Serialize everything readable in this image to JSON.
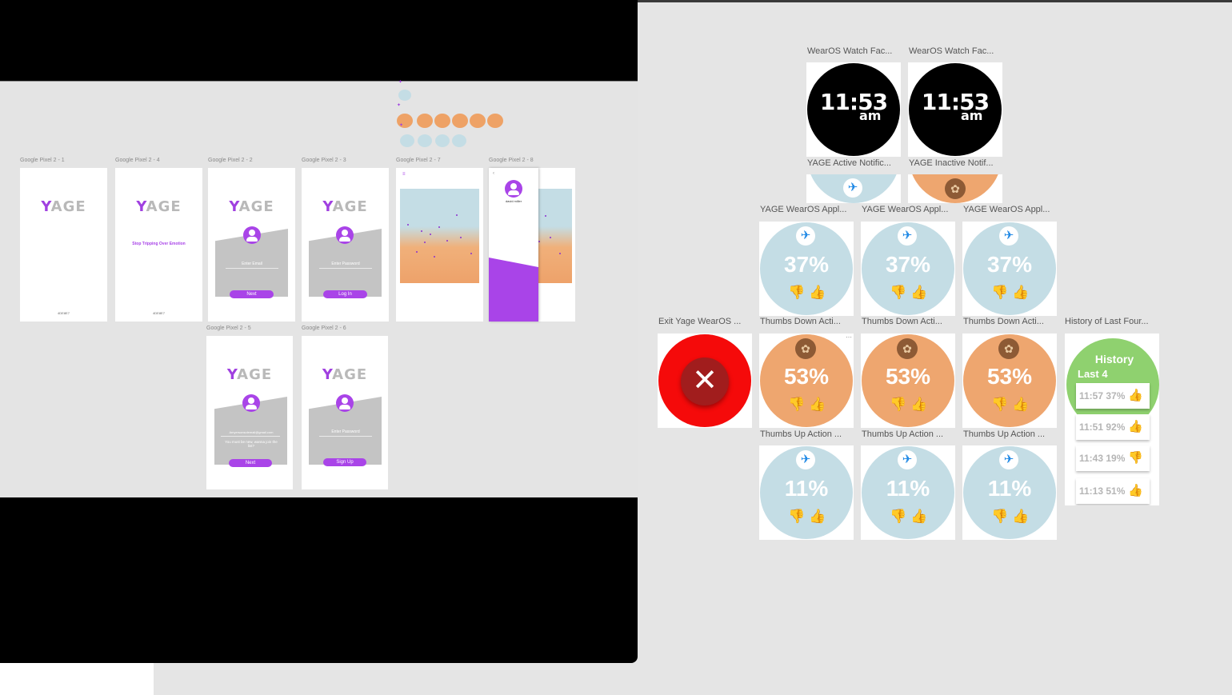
{
  "embed": {
    "frames_row1": [
      {
        "label": "Google Pixel 2 - 1"
      },
      {
        "label": "Google Pixel 2 - 4"
      },
      {
        "label": "Google Pixel 2 - 2"
      },
      {
        "label": "Google Pixel 2 - 3"
      },
      {
        "label": "Google Pixel 2 - 7"
      },
      {
        "label": "Google Pixel 2 - 8"
      }
    ],
    "frames_row2": [
      {
        "label": "Google Pixel 2 - 5"
      },
      {
        "label": "Google Pixel 2 - 6"
      }
    ],
    "logo_text": "YAGE",
    "tagline": "Stop Tripping Over Emotion",
    "footer_code": "4DE8E7",
    "enter_email": "Enter Email",
    "enter_password": "Enter Password",
    "next": "Next",
    "login": "Log In",
    "signup": "Sign Up",
    "sample_email": "Amyersonsolemail@gmail.com",
    "waitlist_note": "You must be new, wanna join the list?",
    "profile_name": "david miller"
  },
  "right": {
    "watch_faces": [
      {
        "label": "WearOS Watch Fac...",
        "time": "11:53",
        "ampm": "am"
      },
      {
        "label": "WearOS Watch Fac...",
        "time": "11:53",
        "ampm": "am"
      }
    ],
    "notifications": [
      {
        "label": "YAGE Active Notific..."
      },
      {
        "label": "YAGE Inactive Notif..."
      }
    ],
    "app_row": {
      "labels": [
        "YAGE WearOS Appl...",
        "YAGE WearOS Appl...",
        "YAGE WearOS Appl..."
      ],
      "percent": "37%"
    },
    "exit": {
      "label": "Exit Yage WearOS ..."
    },
    "down_row": {
      "labels": [
        "Thumbs Down Acti...",
        "Thumbs Down Acti...",
        "Thumbs Down Acti..."
      ],
      "percent": "53%"
    },
    "up_row": {
      "labels": [
        "Thumbs Up Action ...",
        "Thumbs Up Action ...",
        "Thumbs Up Action ..."
      ],
      "percent": "11%"
    },
    "history": {
      "label": "History of Last Four...",
      "title": "History",
      "subtitle": "Last 4",
      "rows": [
        {
          "time": "11:57",
          "pct": "37%",
          "thumb": "up"
        },
        {
          "time": "11:51",
          "pct": "92%",
          "thumb": "up"
        },
        {
          "time": "11:43",
          "pct": "19%",
          "thumb": "down"
        },
        {
          "time": "11:13",
          "pct": "51%",
          "thumb": "up"
        }
      ]
    },
    "colors": {
      "blue_face": "#c4dde5",
      "orange_face": "#eea66f",
      "exit_red": "#f50a0a",
      "history_green": "#8fd16f",
      "accent_purple": "#a944e8"
    }
  }
}
